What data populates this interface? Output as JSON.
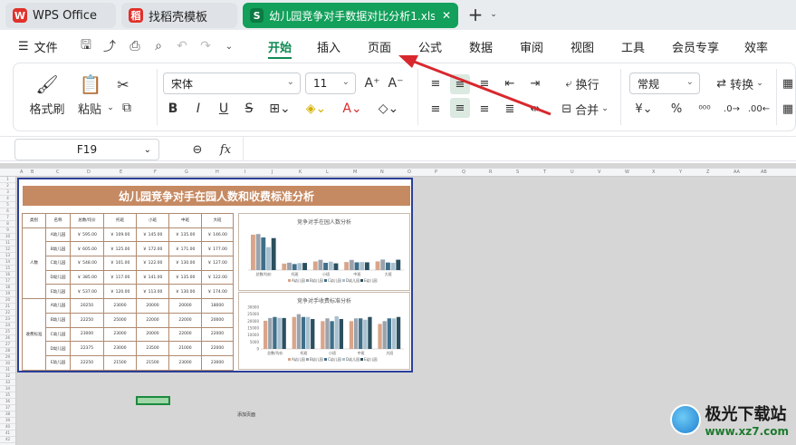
{
  "tabs": [
    {
      "label": "WPS Office",
      "logo": "W"
    },
    {
      "label": "找稻壳模板",
      "logo": "稻"
    },
    {
      "label": "幼儿园竞争对手数据对比分析1.xlsx",
      "logo": "S"
    }
  ],
  "menu": {
    "file": "文件",
    "items": [
      "开始",
      "插入",
      "页面",
      "公式",
      "数据",
      "审阅",
      "视图",
      "工具",
      "会员专享",
      "效率"
    ],
    "active": "开始"
  },
  "ribbon": {
    "format_painter": "格式刷",
    "paste": "粘贴",
    "font_name": "宋体",
    "font_size": "11",
    "wrap": "换行",
    "merge": "合并",
    "number_format": "常规",
    "convert": "转换"
  },
  "formula_bar": {
    "cell_ref": "F19",
    "fx": "fx",
    "value": ""
  },
  "sheet": {
    "title": "幼儿园竞争对手在园人数和收费标准分析",
    "header": [
      "类别",
      "名称",
      "总数/均价",
      "托班",
      "小班",
      "中班",
      "大班"
    ],
    "group1": "人数",
    "group2": "收费标准",
    "rows": [
      [
        "A幼儿园",
        "￥ 595.00",
        "￥ 109.00",
        "￥ 145.00",
        "￥ 135.00",
        "￥ 146.00"
      ],
      [
        "B幼儿园",
        "￥ 605.00",
        "￥ 125.00",
        "￥ 172.00",
        "￥ 171.00",
        "￥ 177.00"
      ],
      [
        "C幼儿园",
        "￥ 548.00",
        "￥ 101.00",
        "￥ 122.00",
        "￥ 130.00",
        "￥ 127.00"
      ],
      [
        "D幼儿园",
        "￥ 385.00",
        "￥ 117.00",
        "￥ 141.00",
        "￥ 135.00",
        "￥ 122.00"
      ],
      [
        "E幼儿园",
        "￥ 537.00",
        "￥ 120.00",
        "￥ 113.00",
        "￥ 130.00",
        "￥ 174.00"
      ],
      [
        "A幼儿园",
        "20250",
        "23000",
        "20000",
        "20000",
        "18000"
      ],
      [
        "B幼儿园",
        "22250",
        "25000",
        "22000",
        "22000",
        "20000"
      ],
      [
        "C幼儿园",
        "23000",
        "23000",
        "20000",
        "22000",
        "22000"
      ],
      [
        "D幼儿园",
        "22375",
        "23000",
        "23500",
        "21000",
        "22000"
      ],
      [
        "E幼儿园",
        "22250",
        "21500",
        "21500",
        "23000",
        "23000"
      ]
    ],
    "sheet_tab": "添加页面"
  },
  "chart_data": [
    {
      "type": "bar",
      "title": "竞争对手在园人数分析",
      "categories": [
        "总数/均价",
        "托班",
        "小班",
        "中班",
        "大班"
      ],
      "series": [
        {
          "name": "A幼儿园",
          "values": [
            595,
            109,
            145,
            135,
            146
          ]
        },
        {
          "name": "B幼儿园",
          "values": [
            605,
            125,
            172,
            171,
            177
          ]
        },
        {
          "name": "C幼儿园",
          "values": [
            548,
            101,
            122,
            130,
            127
          ]
        },
        {
          "name": "D幼儿园",
          "values": [
            385,
            117,
            141,
            135,
            122
          ]
        },
        {
          "name": "E幼儿园",
          "values": [
            537,
            120,
            113,
            130,
            174
          ]
        }
      ],
      "ylim": [
        0,
        700
      ]
    },
    {
      "type": "bar",
      "title": "竞争对手收费标准分析",
      "categories": [
        "总数/均价",
        "托班",
        "小班",
        "中班",
        "大班"
      ],
      "series": [
        {
          "name": "A幼儿园",
          "values": [
            20250,
            23000,
            20000,
            20000,
            18000
          ]
        },
        {
          "name": "B幼儿园",
          "values": [
            22250,
            25000,
            22000,
            22000,
            20000
          ]
        },
        {
          "name": "C幼儿园",
          "values": [
            23000,
            23000,
            20000,
            22000,
            22000
          ]
        },
        {
          "name": "D幼儿园",
          "values": [
            22375,
            23000,
            23500,
            21000,
            22000
          ]
        },
        {
          "name": "E幼儿园",
          "values": [
            22250,
            21500,
            21500,
            23000,
            23000
          ]
        }
      ],
      "yticks": [
        "0",
        "5000",
        "10000",
        "15000",
        "20000",
        "25000",
        "30000"
      ],
      "ylim": [
        0,
        30000
      ]
    }
  ],
  "series_colors": [
    "#d9a58a",
    "#9aa3ad",
    "#3e6f8a",
    "#a8c0cf",
    "#2b4f5f"
  ],
  "watermark": {
    "text": "极光下载站",
    "url": "www.xz7.com"
  }
}
